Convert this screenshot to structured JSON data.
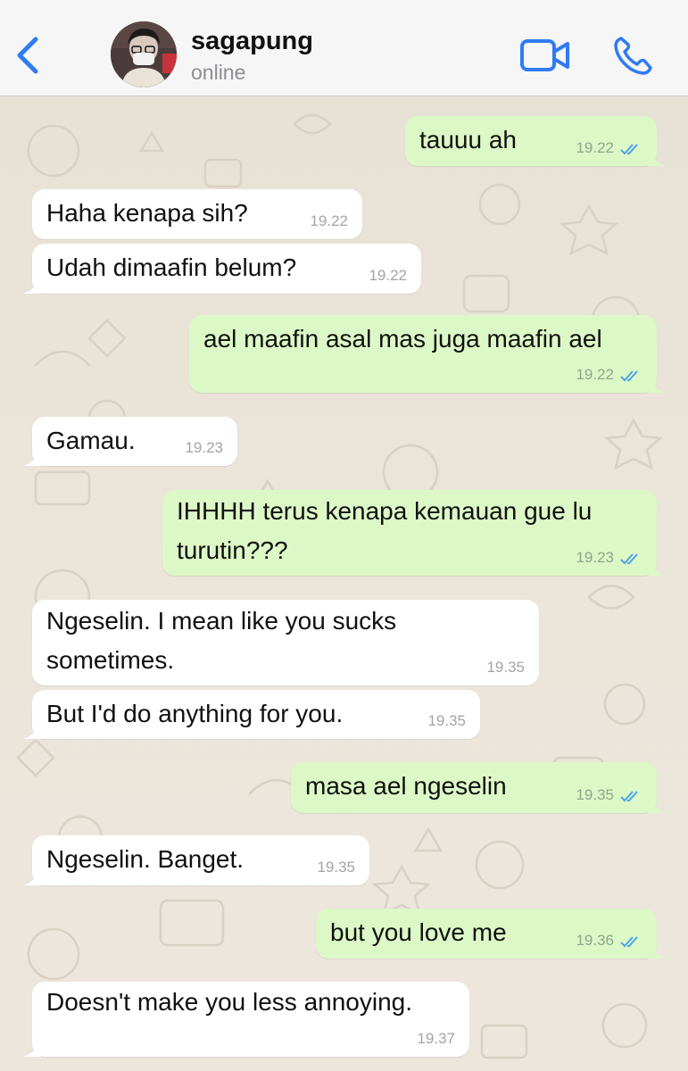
{
  "header": {
    "back_icon": "chevron-left-icon",
    "contact_name": "sagapung",
    "status": "online",
    "video_icon": "video-camera-icon",
    "call_icon": "phone-icon",
    "accent_color": "#2f7bf5"
  },
  "messages": [
    {
      "direction": "out",
      "text": "tauuu ah",
      "time": "19.22",
      "read": true
    },
    {
      "direction": "in",
      "text": "Haha kenapa sih?",
      "time": "19.22"
    },
    {
      "direction": "in",
      "text": "Udah dimaafin belum?",
      "time": "19.22"
    },
    {
      "direction": "out",
      "text": "ael maafin asal mas juga maafin ael",
      "time": "19.22",
      "read": true
    },
    {
      "direction": "in",
      "text": "Gamau.",
      "time": "19.23"
    },
    {
      "direction": "out",
      "text": "IHHHH terus kenapa kemauan gue lu turutin???",
      "time": "19.23",
      "read": true
    },
    {
      "direction": "in",
      "text": "Ngeselin. I mean like you sucks sometimes.",
      "time": "19.35"
    },
    {
      "direction": "in",
      "text": "But I'd do anything for you.",
      "time": "19.35"
    },
    {
      "direction": "out",
      "text": "masa ael ngeselin",
      "time": "19.35",
      "read": true
    },
    {
      "direction": "in",
      "text": "Ngeselin. Banget.",
      "time": "19.35"
    },
    {
      "direction": "out",
      "text": "but you love me",
      "time": "19.36",
      "read": true
    },
    {
      "direction": "in",
      "text": "Doesn't make you less annoying.",
      "time": "19.37"
    }
  ],
  "colors": {
    "incoming_bubble": "#ffffff",
    "outgoing_bubble": "#dcf8c6",
    "read_ticks": "#4fa3e8"
  }
}
